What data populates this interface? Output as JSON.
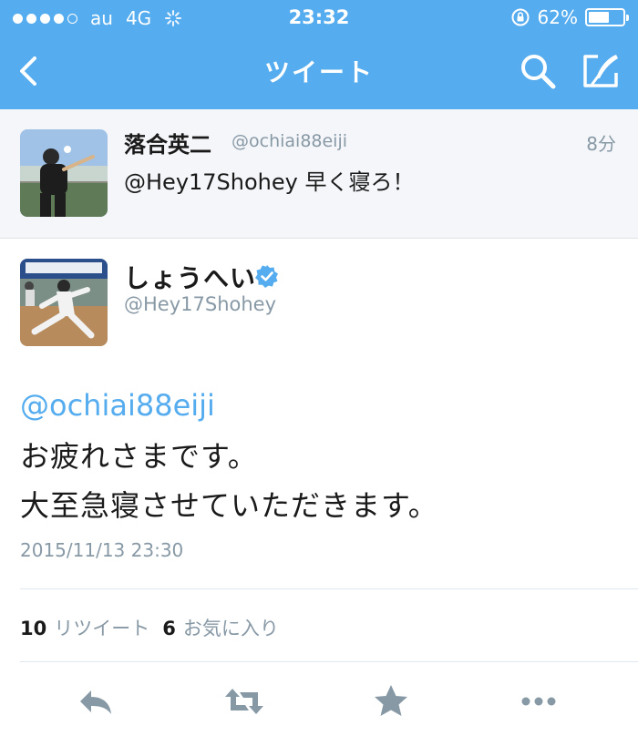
{
  "status_bar": {
    "carrier": "au",
    "network": "4G",
    "time": "23:32",
    "battery_percent": "62%",
    "battery_level": 0.62,
    "signal_bars": 4
  },
  "nav": {
    "title": "ツイート",
    "back_icon": "chevron-left-icon",
    "search_icon": "search-icon",
    "compose_icon": "compose-icon"
  },
  "parent_tweet": {
    "name": "落合英二",
    "handle": "@ochiai88eiji",
    "time_ago": "8分",
    "text": "@Hey17Shohey 早く寝ろ！"
  },
  "main_tweet": {
    "name": "しょうへい",
    "verified": true,
    "handle": "@Hey17Shohey",
    "mention": "@ochiai88eiji",
    "line1": "お疲れさまです。",
    "line2": "大至急寝させていただきます。",
    "timestamp": "2015/11/13 23:30",
    "retweet_count": "10",
    "retweet_label": "リツイート",
    "favorite_count": "6",
    "favorite_label": "お気に入り"
  },
  "actions": [
    "reply-icon",
    "retweet-icon",
    "favorite-star-icon",
    "more-icon"
  ],
  "colors": {
    "accent": "#55acee",
    "muted_text": "#8899a6",
    "parent_background": "#f4f6f9",
    "action_icon": "#8899a6"
  }
}
